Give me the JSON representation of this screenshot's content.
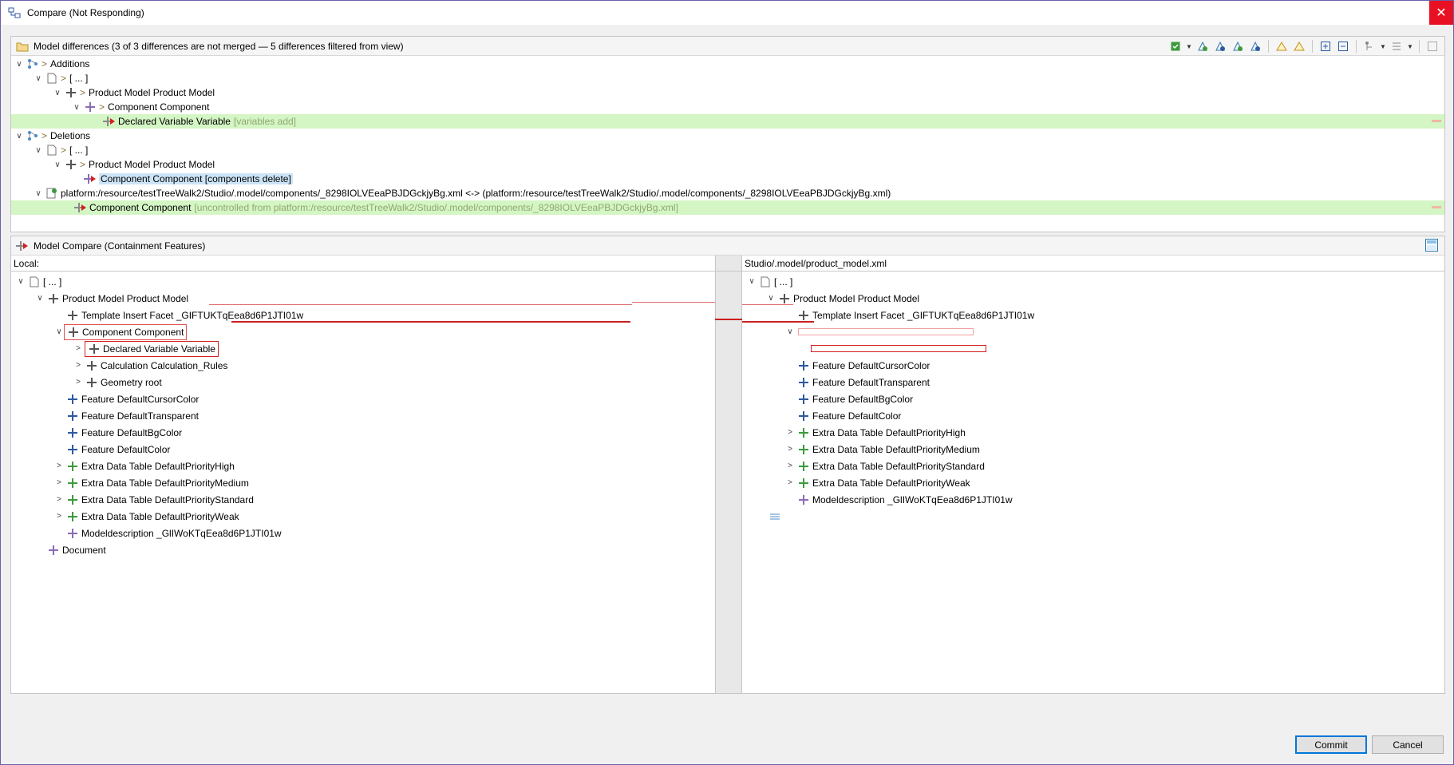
{
  "window": {
    "title": "Compare (Not Responding)",
    "close_glyph": "✕"
  },
  "differences": {
    "header": "Model differences  (3 of 3 differences are not merged — 5 differences filtered from view)",
    "rows": [
      {
        "text": "Additions",
        "prefix": ">",
        "suffix": ""
      },
      {
        "text": "[ ... ]",
        "prefix": ">",
        "suffix": ""
      },
      {
        "text": "Product Model Product Model",
        "prefix": ">",
        "suffix": ""
      },
      {
        "text": "Component Component",
        "prefix": ">",
        "suffix": ""
      },
      {
        "text": "Declared Variable Variable",
        "prefix": "",
        "suffix": "[variables add]"
      },
      {
        "text": "Deletions",
        "prefix": ">",
        "suffix": ""
      },
      {
        "text": "[ ... ]",
        "prefix": ">",
        "suffix": ""
      },
      {
        "text": "Product Model Product Model",
        "prefix": ">",
        "suffix": ""
      },
      {
        "text": "Component Component [components delete]",
        "prefix": "",
        "suffix": ""
      },
      {
        "text": "platform:/resource/testTreeWalk2/Studio/.model/components/_8298IOLVEeaPBJDGckjyBg.xml <->  (platform:/resource/testTreeWalk2/Studio/.model/components/_8298IOLVEeaPBJDGckjyBg.xml)",
        "prefix": "",
        "suffix": ""
      },
      {
        "text": "Component Component",
        "prefix": "",
        "suffix": "[uncontrolled from platform:/resource/testTreeWalk2/Studio/.model/components/_8298IOLVEeaPBJDGckjyBg.xml]"
      }
    ]
  },
  "compare": {
    "header": "Model Compare (Containment Features)",
    "left_header": "Local:",
    "right_header": "Studio/.model/product_model.xml",
    "left_rows": [
      "[ ... ]",
      "Product Model Product Model",
      "Template Insert Facet _GIFTUKTqEea8d6P1JTI01w",
      "Component Component",
      "Declared Variable Variable",
      "Calculation Calculation_Rules",
      "Geometry root",
      "Feature DefaultCursorColor",
      "Feature DefaultTransparent",
      "Feature DefaultBgColor",
      "Feature DefaultColor",
      "Extra Data Table DefaultPriorityHigh",
      "Extra Data Table DefaultPriorityMedium",
      "Extra Data Table DefaultPriorityStandard",
      "Extra Data Table DefaultPriorityWeak",
      "Modeldescription _GlIWoKTqEea8d6P1JTI01w",
      "Document"
    ],
    "right_rows": [
      "[ ... ]",
      "Product Model Product Model",
      "Template Insert Facet _GIFTUKTqEea8d6P1JTI01w",
      "Feature DefaultCursorColor",
      "Feature DefaultTransparent",
      "Feature DefaultBgColor",
      "Feature DefaultColor",
      "Extra Data Table DefaultPriorityHigh",
      "Extra Data Table DefaultPriorityMedium",
      "Extra Data Table DefaultPriorityStandard",
      "Extra Data Table DefaultPriorityWeak",
      "Modeldescription _GlIWoKTqEea8d6P1JTI01w"
    ]
  },
  "buttons": {
    "commit": "Commit",
    "cancel": "Cancel"
  },
  "colors": {
    "highlight": "#d4f5c4",
    "diff_red": "#d42020",
    "close": "#e81123",
    "selection": "#cce4f7"
  }
}
